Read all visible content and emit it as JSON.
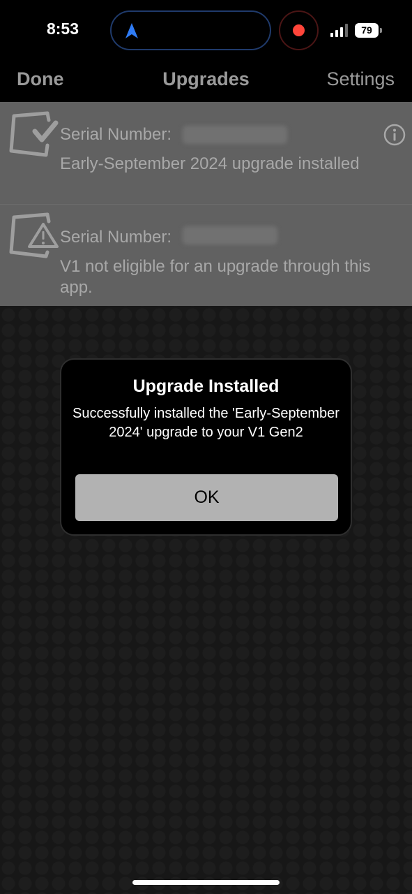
{
  "status_bar": {
    "time": "8:53",
    "battery": "79",
    "icons": [
      "navigation-arrow-icon",
      "recording-dot-icon",
      "signal-bars-icon",
      "battery-icon"
    ]
  },
  "nav": {
    "left": "Done",
    "title": "Upgrades",
    "right": "Settings"
  },
  "devices": [
    {
      "serial_label": "Serial Number:",
      "status": "Early-September 2024 upgrade installed",
      "icon": "device-check-icon",
      "has_info": true
    },
    {
      "serial_label": "Serial Number:",
      "status": "V1 not eligible for an upgrade through this app.",
      "icon": "device-warning-icon",
      "has_info": false
    }
  ],
  "alert": {
    "title": "Upgrade Installed",
    "message": "Successfully installed the 'Early-September 2024' upgrade to your V1 Gen2",
    "button": "OK"
  },
  "colors": {
    "accent_blue": "#2f7cf6",
    "record_red": "#ff453a",
    "list_background": "#616161",
    "button_gray": "#b2b2b2"
  }
}
